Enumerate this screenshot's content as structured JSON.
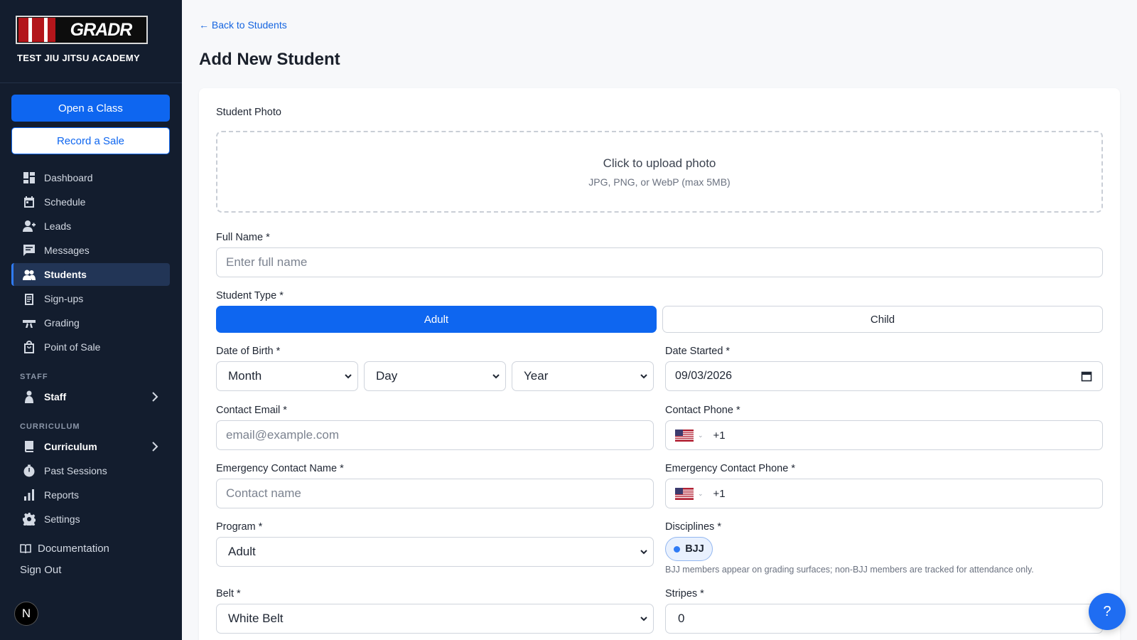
{
  "brand": {
    "logo_text": "GRADR",
    "academy": "TEST JIU JITSU ACADEMY"
  },
  "sidebar": {
    "open_class": "Open a Class",
    "record_sale": "Record a Sale",
    "items": [
      {
        "label": "Dashboard",
        "icon": "dashboard-icon"
      },
      {
        "label": "Schedule",
        "icon": "calendar-icon"
      },
      {
        "label": "Leads",
        "icon": "add-user-icon"
      },
      {
        "label": "Messages",
        "icon": "message-icon"
      },
      {
        "label": "Students",
        "icon": "users-icon",
        "active": true
      },
      {
        "label": "Sign-ups",
        "icon": "clipboard-icon"
      },
      {
        "label": "Grading",
        "icon": "belt-icon"
      },
      {
        "label": "Point of Sale",
        "icon": "bag-icon"
      }
    ],
    "staff_section": "STAFF",
    "staff": "Staff",
    "curriculum_section": "CURRICULUM",
    "curriculum": "Curriculum",
    "past_sessions": "Past Sessions",
    "reports": "Reports",
    "settings": "Settings",
    "documentation": "Documentation",
    "sign_out": "Sign Out",
    "avatar_letter": "N"
  },
  "page": {
    "back_link": "← Back to Students",
    "title": "Add New Student"
  },
  "form": {
    "photo_label": "Student Photo",
    "upload_title": "Click to upload photo",
    "upload_hint": "JPG, PNG, or WebP (max 5MB)",
    "full_name_label": "Full Name *",
    "full_name_placeholder": "Enter full name",
    "student_type_label": "Student Type *",
    "type_adult": "Adult",
    "type_child": "Child",
    "dob_label": "Date of Birth *",
    "dob_month": "Month",
    "dob_day": "Day",
    "dob_year": "Year",
    "date_started_label": "Date Started *",
    "date_started_value": "09/03/2026",
    "email_label": "Contact Email *",
    "email_placeholder": "email@example.com",
    "phone_label": "Contact Phone *",
    "phone_code": "+1",
    "emergency_name_label": "Emergency Contact Name *",
    "emergency_name_placeholder": "Contact name",
    "emergency_phone_label": "Emergency Contact Phone *",
    "emergency_phone_code": "+1",
    "program_label": "Program *",
    "program_value": "Adult",
    "disciplines_label": "Disciplines *",
    "discipline_chip": "BJJ",
    "disciplines_hint": "BJJ members appear on grading surfaces; non-BJJ members are tracked for attendance only.",
    "belt_label": "Belt *",
    "belt_value": "White Belt",
    "stripes_label": "Stripes *",
    "stripes_value": "0"
  },
  "help_button": "?",
  "colors": {
    "sidebar_bg": "#131d2e",
    "accent": "#0e66f0",
    "page_bg": "#f7f8fa"
  }
}
